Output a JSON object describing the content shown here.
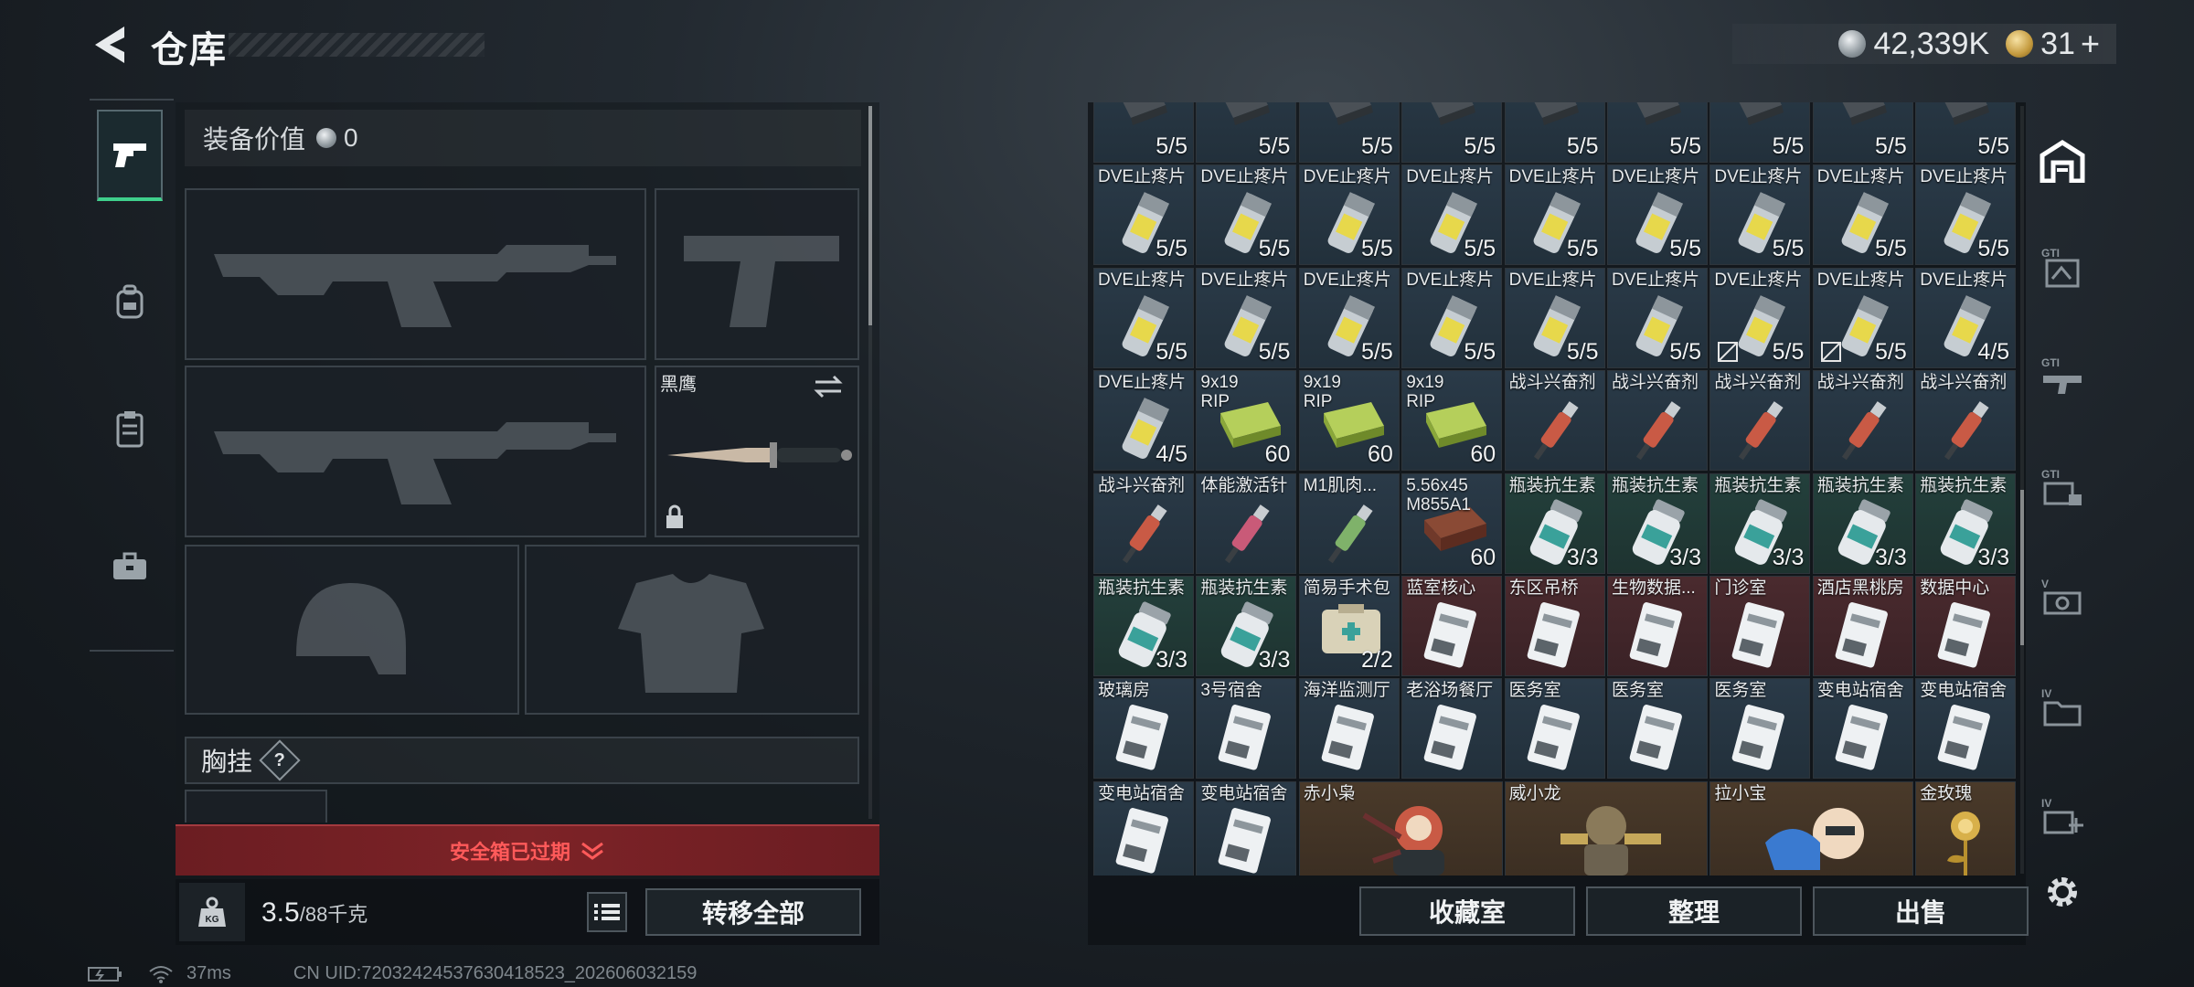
{
  "header": {
    "title": "仓库",
    "currency": [
      {
        "icon": "silver-coin-icon",
        "value": "42,339K"
      },
      {
        "icon": "gold-coin-icon",
        "value": "31"
      }
    ],
    "add_label": "+"
  },
  "left_rail": {
    "items": [
      {
        "name": "weapon-tab",
        "icon": "pistol-icon",
        "active": true
      },
      {
        "name": "backpack-tab",
        "icon": "backpack-icon",
        "active": false
      },
      {
        "name": "vest-tab",
        "icon": "vest-icon",
        "active": false
      },
      {
        "name": "case-tab",
        "icon": "briefcase-icon",
        "active": false
      }
    ]
  },
  "equipment": {
    "value_label": "装备价值",
    "value": "0",
    "knife_name": "黑鹰",
    "chest_rig_label": "胸挂",
    "chest_rig_help": "?",
    "safebox_text": "安全箱已过期",
    "weight_current": "3.5",
    "weight_max": "/88千克",
    "transfer_all_label": "转移全部"
  },
  "storage": {
    "rows": [
      [
        {
          "name": "",
          "count": "5/5",
          "color": "blue",
          "icon": "magazine"
        },
        {
          "name": "",
          "count": "5/5",
          "color": "blue",
          "icon": "magazine"
        },
        {
          "name": "",
          "count": "5/5",
          "color": "blue",
          "icon": "magazine"
        },
        {
          "name": "",
          "count": "5/5",
          "color": "blue",
          "icon": "magazine"
        },
        {
          "name": "",
          "count": "5/5",
          "color": "blue",
          "icon": "magazine"
        },
        {
          "name": "",
          "count": "5/5",
          "color": "blue",
          "icon": "magazine"
        },
        {
          "name": "",
          "count": "5/5",
          "color": "blue",
          "icon": "magazine"
        },
        {
          "name": "",
          "count": "5/5",
          "color": "blue",
          "icon": "magazine"
        },
        {
          "name": "",
          "count": "5/5",
          "color": "blue",
          "icon": "magazine"
        }
      ],
      [
        {
          "name": "DVE止疼片",
          "count": "5/5",
          "color": "blue",
          "icon": "pill"
        },
        {
          "name": "DVE止疼片",
          "count": "5/5",
          "color": "blue",
          "icon": "pill"
        },
        {
          "name": "DVE止疼片",
          "count": "5/5",
          "color": "blue",
          "icon": "pill"
        },
        {
          "name": "DVE止疼片",
          "count": "5/5",
          "color": "blue",
          "icon": "pill"
        },
        {
          "name": "DVE止疼片",
          "count": "5/5",
          "color": "blue",
          "icon": "pill"
        },
        {
          "name": "DVE止疼片",
          "count": "5/5",
          "color": "blue",
          "icon": "pill"
        },
        {
          "name": "DVE止疼片",
          "count": "5/5",
          "color": "blue",
          "icon": "pill"
        },
        {
          "name": "DVE止疼片",
          "count": "5/5",
          "color": "blue",
          "icon": "pill"
        },
        {
          "name": "DVE止疼片",
          "count": "5/5",
          "color": "blue",
          "icon": "pill"
        }
      ],
      [
        {
          "name": "DVE止疼片",
          "count": "5/5",
          "color": "blue",
          "icon": "pill"
        },
        {
          "name": "DVE止疼片",
          "count": "5/5",
          "color": "blue",
          "icon": "pill"
        },
        {
          "name": "DVE止疼片",
          "count": "5/5",
          "color": "blue",
          "icon": "pill"
        },
        {
          "name": "DVE止疼片",
          "count": "5/5",
          "color": "blue",
          "icon": "pill"
        },
        {
          "name": "DVE止疼片",
          "count": "5/5",
          "color": "blue",
          "icon": "pill"
        },
        {
          "name": "DVE止疼片",
          "count": "5/5",
          "color": "blue",
          "icon": "pill"
        },
        {
          "name": "DVE止疼片",
          "count": "5/5",
          "color": "blue",
          "icon": "pill",
          "nodisc": true
        },
        {
          "name": "DVE止疼片",
          "count": "5/5",
          "color": "blue",
          "icon": "pill",
          "nodisc": true
        },
        {
          "name": "DVE止疼片",
          "count": "4/5",
          "color": "blue",
          "icon": "pill"
        }
      ],
      [
        {
          "name": "DVE止疼片",
          "count": "4/5",
          "color": "blue",
          "icon": "pill"
        },
        {
          "name": "9x19\nRIP",
          "count": "60",
          "color": "blue",
          "icon": "ammo-green"
        },
        {
          "name": "9x19\nRIP",
          "count": "60",
          "color": "blue",
          "icon": "ammo-green"
        },
        {
          "name": "9x19\nRIP",
          "count": "60",
          "color": "blue",
          "icon": "ammo-green"
        },
        {
          "name": "战斗兴奋剂",
          "count": "",
          "color": "blue",
          "icon": "injector-red"
        },
        {
          "name": "战斗兴奋剂",
          "count": "",
          "color": "blue",
          "icon": "injector-red"
        },
        {
          "name": "战斗兴奋剂",
          "count": "",
          "color": "blue",
          "icon": "injector-red"
        },
        {
          "name": "战斗兴奋剂",
          "count": "",
          "color": "blue",
          "icon": "injector-red"
        },
        {
          "name": "战斗兴奋剂",
          "count": "",
          "color": "blue",
          "icon": "injector-red"
        }
      ],
      [
        {
          "name": "战斗兴奋剂",
          "count": "",
          "color": "blue",
          "icon": "injector-red"
        },
        {
          "name": "体能激活针",
          "count": "",
          "color": "blue",
          "icon": "injector-pink"
        },
        {
          "name": "M1肌肉...",
          "count": "",
          "color": "blue",
          "icon": "injector-green"
        },
        {
          "name": "5.56x45\nM855A1",
          "count": "60",
          "color": "blue",
          "icon": "ammo-box"
        },
        {
          "name": "瓶装抗生素",
          "count": "3/3",
          "color": "green",
          "icon": "bottle"
        },
        {
          "name": "瓶装抗生素",
          "count": "3/3",
          "color": "green",
          "icon": "bottle"
        },
        {
          "name": "瓶装抗生素",
          "count": "3/3",
          "color": "green",
          "icon": "bottle"
        },
        {
          "name": "瓶装抗生素",
          "count": "3/3",
          "color": "green",
          "icon": "bottle"
        },
        {
          "name": "瓶装抗生素",
          "count": "3/3",
          "color": "green",
          "icon": "bottle"
        }
      ],
      [
        {
          "name": "瓶装抗生素",
          "count": "3/3",
          "color": "green",
          "icon": "bottle"
        },
        {
          "name": "瓶装抗生素",
          "count": "3/3",
          "color": "green",
          "icon": "bottle"
        },
        {
          "name": "简易手术包",
          "count": "2/2",
          "color": "blue",
          "icon": "kit"
        },
        {
          "name": "蓝室核心",
          "count": "",
          "color": "red",
          "icon": "card"
        },
        {
          "name": "东区吊桥",
          "count": "",
          "color": "red",
          "icon": "card"
        },
        {
          "name": "生物数据...",
          "count": "",
          "color": "red",
          "icon": "card"
        },
        {
          "name": "门诊室",
          "count": "",
          "color": "red",
          "icon": "card"
        },
        {
          "name": "酒店黑桃房",
          "count": "",
          "color": "red",
          "icon": "card"
        },
        {
          "name": "数据中心",
          "count": "",
          "color": "red",
          "icon": "card"
        }
      ],
      [
        {
          "name": "玻璃房",
          "count": "",
          "color": "blue",
          "icon": "card"
        },
        {
          "name": "3号宿舍",
          "count": "",
          "color": "blue",
          "icon": "card"
        },
        {
          "name": "海洋监测厅",
          "count": "",
          "color": "blue",
          "icon": "card"
        },
        {
          "name": "老浴场餐厅",
          "count": "",
          "color": "blue",
          "icon": "card"
        },
        {
          "name": "医务室",
          "count": "",
          "color": "blue",
          "icon": "card"
        },
        {
          "name": "医务室",
          "count": "",
          "color": "blue",
          "icon": "card"
        },
        {
          "name": "医务室",
          "count": "",
          "color": "blue",
          "icon": "card"
        },
        {
          "name": "变电站宿舍",
          "count": "",
          "color": "blue",
          "icon": "card"
        },
        {
          "name": "变电站宿舍",
          "count": "",
          "color": "blue",
          "icon": "card"
        }
      ],
      [
        {
          "name": "变电站宿舍",
          "count": "",
          "color": "blue",
          "icon": "card"
        },
        {
          "name": "变电站宿舍",
          "count": "",
          "color": "blue",
          "icon": "card"
        },
        {
          "name": "赤小枭",
          "count": "",
          "color": "gold",
          "icon": "figurine-red",
          "wide": true
        },
        {
          "name": "威小龙",
          "count": "",
          "color": "gold",
          "icon": "figurine-gold",
          "wide": true
        },
        {
          "name": "拉小宝",
          "count": "",
          "color": "gold",
          "icon": "figurine-blue",
          "wide": true
        },
        {
          "name": "金玫瑰",
          "count": "",
          "color": "gold",
          "icon": "rose"
        }
      ]
    ],
    "buttons": {
      "collection": "收藏室",
      "sort": "整理",
      "sell": "出售"
    }
  },
  "right_rail": {
    "items": [
      {
        "name": "warehouse-tab",
        "icon": "warehouse-icon",
        "active": true
      },
      {
        "name": "storage-expand-1",
        "icon": "gti-expand-icon"
      },
      {
        "name": "storage-expand-2",
        "icon": "gti-gun-icon"
      },
      {
        "name": "storage-expand-3",
        "icon": "gti-lock-icon"
      },
      {
        "name": "storage-expand-4",
        "icon": "v-case-icon"
      },
      {
        "name": "storage-expand-5",
        "icon": "iv-folder-icon"
      },
      {
        "name": "storage-expand-6",
        "icon": "iv-add-icon"
      },
      {
        "name": "settings",
        "icon": "gear-icon"
      }
    ]
  },
  "status": {
    "ping": "37ms",
    "uid": "CN UID:72032424537630418523_202606032159"
  }
}
